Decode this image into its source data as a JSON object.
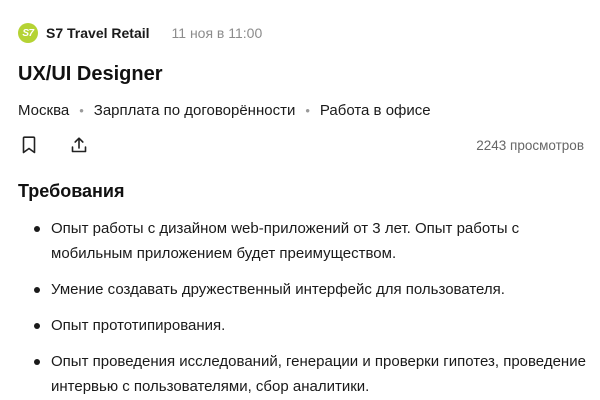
{
  "company": {
    "logo_text": "S7",
    "logo_color": "#b5d334",
    "name": "S7 Travel Retail",
    "date": "11 ноя в 11:00"
  },
  "job": {
    "title": "UX/UI Designer",
    "location": "Москва",
    "salary": "Зарплата по договорённости",
    "work_format": "Работа в офисе",
    "separator": "•"
  },
  "actions": {
    "bookmark_icon": "bookmark-icon",
    "share_icon": "share-icon",
    "views": "2243 просмотров"
  },
  "requirements": {
    "title": "Требования",
    "items": [
      "Опыт работы с дизайном web-приложений от 3 лет. Опыт работы с мобильным приложением будет преимуществом.",
      "Умение создавать дружественный интерфейс для пользователя.",
      "Опыт прототипирования.",
      "Опыт проведения исследований, генерации и проверки гипотез, проведение интервью с пользователями, сбор аналитики."
    ]
  }
}
